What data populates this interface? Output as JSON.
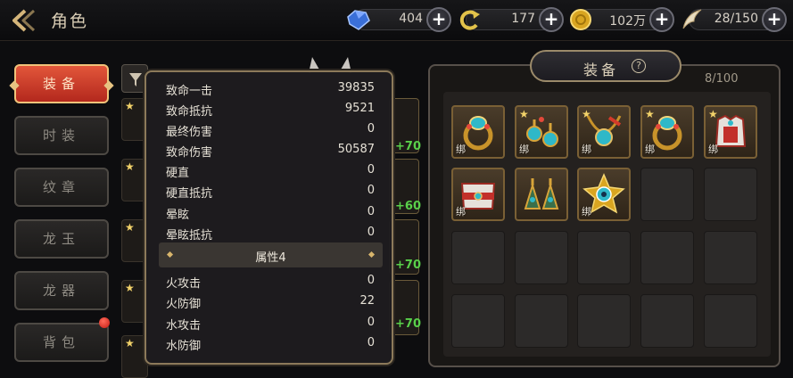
{
  "header": {
    "title": "角色",
    "resources": [
      {
        "icon": "gem-icon",
        "value": "404"
      },
      {
        "icon": "stamina-icon",
        "value": "177"
      },
      {
        "icon": "gold-coin-icon",
        "value": "102万"
      },
      {
        "icon": "wing-icon",
        "value": "28/150"
      }
    ],
    "plus_label": "+"
  },
  "side_tabs": [
    {
      "label": "装备",
      "active": true
    },
    {
      "label": "时装",
      "active": false
    },
    {
      "label": "纹章",
      "active": false
    },
    {
      "label": "龙玉",
      "active": false
    },
    {
      "label": "龙器",
      "active": false
    },
    {
      "label": "背包",
      "active": false
    }
  ],
  "gear_bonus": [
    "+70",
    "+60",
    "+70",
    "+70"
  ],
  "stats_popup": {
    "rows_top": [
      {
        "label": "致命一击",
        "value": "39835"
      },
      {
        "label": "致命抵抗",
        "value": "9521"
      },
      {
        "label": "最终伤害",
        "value": "0"
      },
      {
        "label": "致命伤害",
        "value": "50587"
      },
      {
        "label": "硬直",
        "value": "0"
      },
      {
        "label": "硬直抵抗",
        "value": "0"
      },
      {
        "label": "晕眩",
        "value": "0"
      },
      {
        "label": "晕眩抵抗",
        "value": "0"
      }
    ],
    "section_title": "属性4",
    "rows_bottom": [
      {
        "label": "火攻击",
        "value": "0"
      },
      {
        "label": "火防御",
        "value": "22"
      },
      {
        "label": "水攻击",
        "value": "0"
      },
      {
        "label": "水防御",
        "value": "0"
      }
    ]
  },
  "equipment": {
    "title": "装备",
    "help": "?",
    "count": "8/100",
    "bind_label": "绑",
    "items": [
      {
        "kind": "ring-icon",
        "star": true,
        "bound": true
      },
      {
        "kind": "earring-icon",
        "star": true,
        "bound": true
      },
      {
        "kind": "necklace-icon",
        "star": true,
        "bound": true
      },
      {
        "kind": "ring-icon",
        "star": true,
        "bound": true
      },
      {
        "kind": "armor-icon",
        "star": true,
        "bound": true
      },
      {
        "kind": "belt-icon",
        "star": false,
        "bound": true
      },
      {
        "kind": "earring-icon",
        "star": false,
        "bound": false
      },
      {
        "kind": "eye-amulet-icon",
        "star": false,
        "bound": true
      }
    ]
  },
  "colors": {
    "active_tab": "#d7422c",
    "gold_trim": "#9b8a6a",
    "bonus_green": "#59d04a"
  }
}
